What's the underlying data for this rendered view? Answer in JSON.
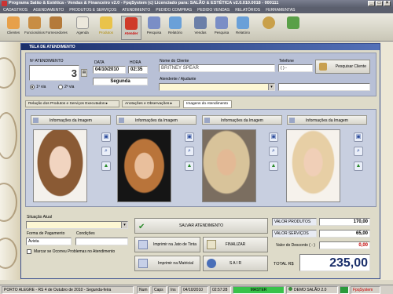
{
  "window": {
    "title": "Programa Salão & Estética - Vendas & Financeiro v2.0 - FpqSystem (c) Licenciado para: SALÃO & ESTÉTICA v2.0.010.0018 - 000111"
  },
  "menu": [
    "CADASTROS",
    "AGENDAMENTO",
    "PRODUTOS E SERVIÇOS",
    "ATENDIMENTO",
    "PEDIDO COMPRAS",
    "PEDIDO VENDAS",
    "RELATÓRIOS",
    "FERRAMENTAS"
  ],
  "toolbar": [
    {
      "label": "Clientes",
      "icon": "people-icon",
      "color": "#e7a04a"
    },
    {
      "label": "Funcionários",
      "icon": "person-icon",
      "color": "#c88d44"
    },
    {
      "label": "Fornecedores",
      "icon": "supplier-icon",
      "color": "#b47a3a"
    },
    {
      "label": "Agenda",
      "icon": "calendar-icon",
      "color": "#ece8dc"
    },
    {
      "label": "Produtos",
      "icon": "products-icon",
      "color": "#e9c34a"
    },
    {
      "label": "Atender",
      "icon": "scissors-icon",
      "color": "#cf3a2a"
    },
    {
      "label": "Pesquisa",
      "icon": "search-icon",
      "color": "#7a8ec6"
    },
    {
      "label": "Relatório",
      "icon": "report-icon",
      "color": "#6aa0d8"
    },
    {
      "label": "Vendas",
      "icon": "cart-icon",
      "color": "#6b7fa8"
    },
    {
      "label": "Pesquisa",
      "icon": "search-icon",
      "color": "#7a8ec6"
    },
    {
      "label": "Relatório",
      "icon": "report-icon",
      "color": "#6aa0d8"
    },
    {
      "label": "",
      "icon": "gear-icon",
      "color": "#c9a04a"
    },
    {
      "label": "",
      "icon": "exit-icon",
      "color": "#5aa048"
    }
  ],
  "form": {
    "title": "TELA DE ATENDIMENTO",
    "atendimento_label": "Nº ATENDIMENTO",
    "atendimento_value": "3",
    "data_label": "DATA",
    "data_value": "04/10/2010",
    "hora_label": "HORA",
    "hora_value": "02:35",
    "weekday": "Segunda",
    "via1": "1ª via",
    "via2": "2ª via",
    "cliente_label": "Nome do Cliente",
    "cliente_value": "BRITNEY SPEAR",
    "telefone_label": "Telefone",
    "telefone_value": "(  )  -",
    "pesquisar_label": "Pesquisar Cliente",
    "atendente_label": "Atendente / Ajudante"
  },
  "tabs": [
    "Relação dos Produtos e Serviços Executados",
    "Anotações e Observações",
    "Imagens do Atendimento"
  ],
  "images": {
    "header_label": "Informações da Imagem"
  },
  "bottom": {
    "situacao_label": "Situação Atual",
    "pagamento_label": "Forma de Pagamento",
    "pagamento_value": "Avista",
    "condicoes_label": "Condições",
    "problemas_label": "Marcar se Ocorreu Problemas no Atendimento",
    "salvar": "SALVAR ATENDIMENTO",
    "imprimir_jato": "Imprimir na Jato de Tinta",
    "finalizar": "FINALIZAR",
    "imprimir_matricial": "Imprimir na Matricial",
    "sair": "S A I R",
    "valor_produtos_label": "VALOR PRODUTOS",
    "valor_produtos": "170,00",
    "valor_servicos_label": "VALOR SERVIÇOS",
    "valor_servicos": "65,00",
    "desconto_label": "Valor do Desconto ( - )",
    "desconto": "0,00",
    "total_label": "TOTAL R$",
    "total": "235,00"
  },
  "statusbar": {
    "location": "PORTO ALEGRE - RS  4 de Outubro de 2010 - Segunda-feira",
    "num": "Num",
    "caps": "Caps",
    "ins": "Ins",
    "date": "04/10/2010",
    "time": "02:57:28",
    "user": "MASTER",
    "company": "DEMO SALÃO 2.0",
    "brand": "FpqSystem"
  },
  "colors": {
    "accent": "#1b2f6a",
    "panel": "#b8c0d6",
    "total": "#1b2f6a",
    "discount": "#c00000"
  }
}
